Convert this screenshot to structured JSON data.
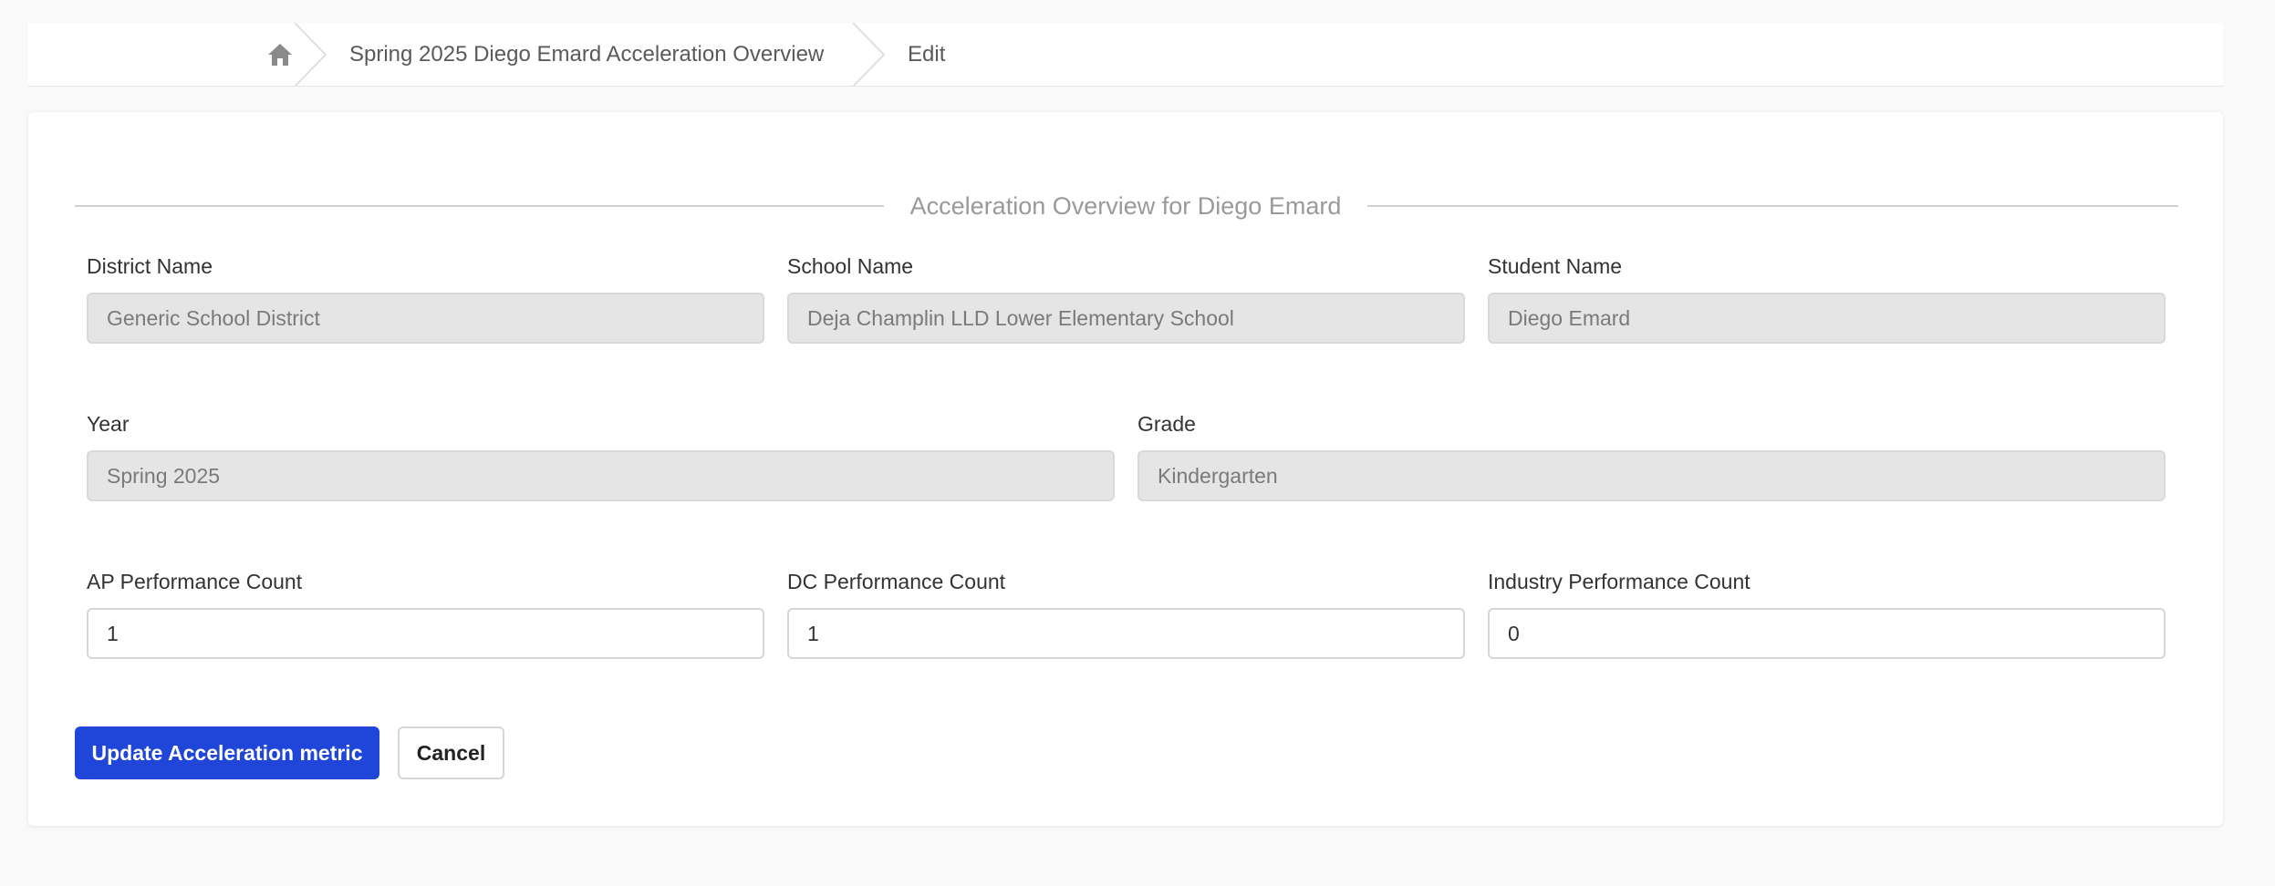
{
  "breadcrumb": {
    "home_icon": "home-icon",
    "items": [
      {
        "label": "Spring 2025 Diego Emard Acceleration Overview"
      },
      {
        "label": "Edit"
      }
    ]
  },
  "form": {
    "legend": "Acceleration Overview for Diego Emard",
    "fields": {
      "district_name": {
        "label": "District Name",
        "value": "Generic School District"
      },
      "school_name": {
        "label": "School Name",
        "value": "Deja Champlin LLD Lower Elementary School"
      },
      "student_name": {
        "label": "Student Name",
        "value": "Diego Emard"
      },
      "year": {
        "label": "Year",
        "value": "Spring 2025"
      },
      "grade": {
        "label": "Grade",
        "value": "Kindergarten"
      },
      "ap_count": {
        "label": "AP Performance Count",
        "value": "1"
      },
      "dc_count": {
        "label": "DC Performance Count",
        "value": "1"
      },
      "industry_count": {
        "label": "Industry Performance Count",
        "value": "0"
      }
    },
    "actions": {
      "submit_label": "Update Acceleration metric",
      "cancel_label": "Cancel"
    }
  },
  "colors": {
    "primary": "#1f46d8",
    "disabled_bg": "#e5e5e5",
    "page_bg": "#f9f9f9"
  }
}
